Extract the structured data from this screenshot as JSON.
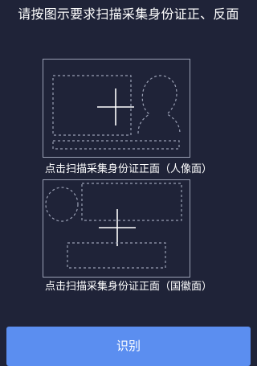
{
  "instruction": "请按图示要求扫描采集身份证正、反面",
  "cards": {
    "front": {
      "caption": "点击扫描采集身份证正面（人像面）"
    },
    "back": {
      "caption": "点击扫描采集身份证正面（国徽面）"
    }
  },
  "actions": {
    "recognize_label": "识别"
  },
  "colors": {
    "background": "#1f2338",
    "frame_border": "#9aa0b4",
    "dashed_placeholder": "#9aa0b4",
    "crosshair": "#ffffff",
    "button_bg": "#5b8ef0",
    "text": "#ffffff"
  },
  "icons": {
    "front_card": [
      "dashed-text-area",
      "portrait-silhouette-icon",
      "plus-icon",
      "dashed-id-number-bar"
    ],
    "back_card": [
      "emblem-circle-icon",
      "dashed-top-bar",
      "plus-icon",
      "dashed-bottom-bar"
    ]
  }
}
